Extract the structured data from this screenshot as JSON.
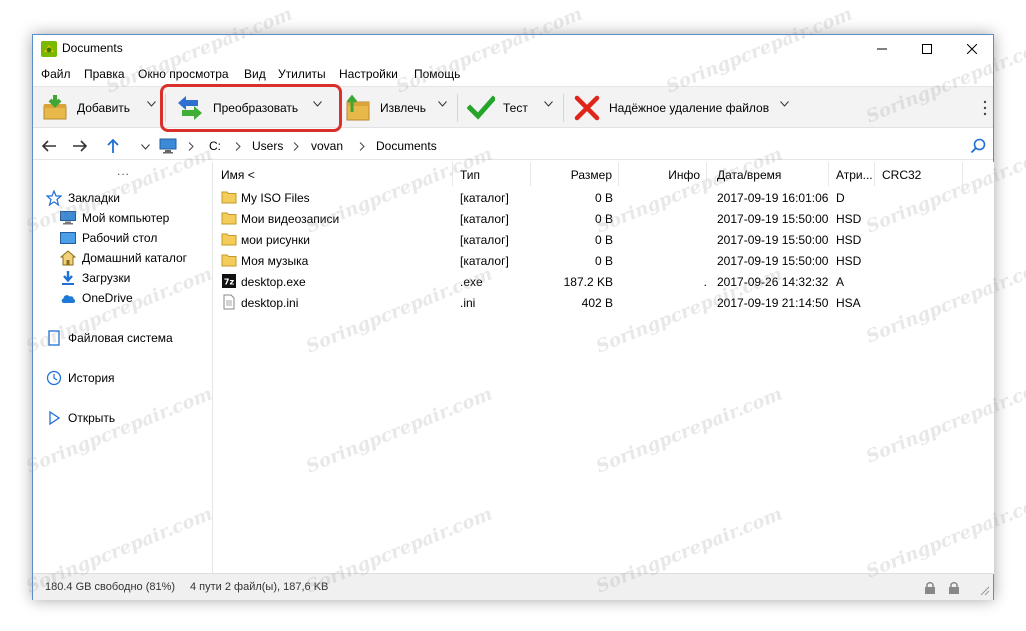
{
  "window": {
    "title": "Documents",
    "icon": "7zip-app-icon"
  },
  "menu": [
    "Файл",
    "Правка",
    "Окно просмотра",
    "Вид",
    "Утилиты",
    "Настройки",
    "Помощь"
  ],
  "toolbar": {
    "add_label": "Добавить",
    "convert_label": "Преобразовать",
    "extract_label": "Извлечь",
    "test_label": "Тест",
    "wipe_label": "Надёжное удаление файлов",
    "highlight_color": "#d9302c"
  },
  "address": {
    "crumbs": [
      "C:",
      "Users",
      "vovan",
      "Documents"
    ]
  },
  "sidebar": {
    "dots": "...",
    "items": [
      {
        "label": "Закладки",
        "icon": "star-icon"
      },
      {
        "label": "Мой компьютер",
        "icon": "monitor-icon"
      },
      {
        "label": "Рабочий стол",
        "icon": "desktop-icon"
      },
      {
        "label": "Домашний каталог",
        "icon": "home-icon"
      },
      {
        "label": "Загрузки",
        "icon": "download-icon"
      },
      {
        "label": "OneDrive",
        "icon": "cloud-icon"
      },
      {
        "label": "Файловая система",
        "icon": "drive-icon"
      },
      {
        "label": "История",
        "icon": "clock-icon"
      },
      {
        "label": "Открыть",
        "icon": "play-icon"
      }
    ]
  },
  "columns": [
    "Имя <",
    "Тип",
    "Размер",
    "Инфо",
    "Дата/время",
    "Атри...",
    "CRC32"
  ],
  "files": [
    {
      "name": "My ISO Files",
      "type": "[каталог]",
      "size": "0 B",
      "info": "",
      "date": "2017-09-19 16:01:06",
      "attr": "D",
      "crc": "",
      "icon": "folder-icon"
    },
    {
      "name": "Мои видеозаписи",
      "type": "[каталог]",
      "size": "0 B",
      "info": "",
      "date": "2017-09-19 15:50:00",
      "attr": "HSD",
      "crc": "",
      "icon": "folder-icon"
    },
    {
      "name": "мои рисунки",
      "type": "[каталог]",
      "size": "0 B",
      "info": "",
      "date": "2017-09-19 15:50:00",
      "attr": "HSD",
      "crc": "",
      "icon": "folder-icon"
    },
    {
      "name": "Моя музыка",
      "type": "[каталог]",
      "size": "0 B",
      "info": "",
      "date": "2017-09-19 15:50:00",
      "attr": "HSD",
      "crc": "",
      "icon": "folder-icon"
    },
    {
      "name": "desktop.exe",
      "type": ".exe",
      "size": "187.2 KB",
      "info": ".",
      "date": "2017-09-26 14:32:32",
      "attr": "A",
      "crc": "",
      "icon": "exe-7z-icon"
    },
    {
      "name": "desktop.ini",
      "type": ".ini",
      "size": "402 B",
      "info": "",
      "date": "2017-09-19 21:14:50",
      "attr": "HSA",
      "crc": "",
      "icon": "document-icon"
    }
  ],
  "status": {
    "free": "180.4 GB свободно (81%)",
    "summary": "4 пути 2 файл(ы), 187,6 KB"
  },
  "watermark": "Soringpcrepair.com"
}
